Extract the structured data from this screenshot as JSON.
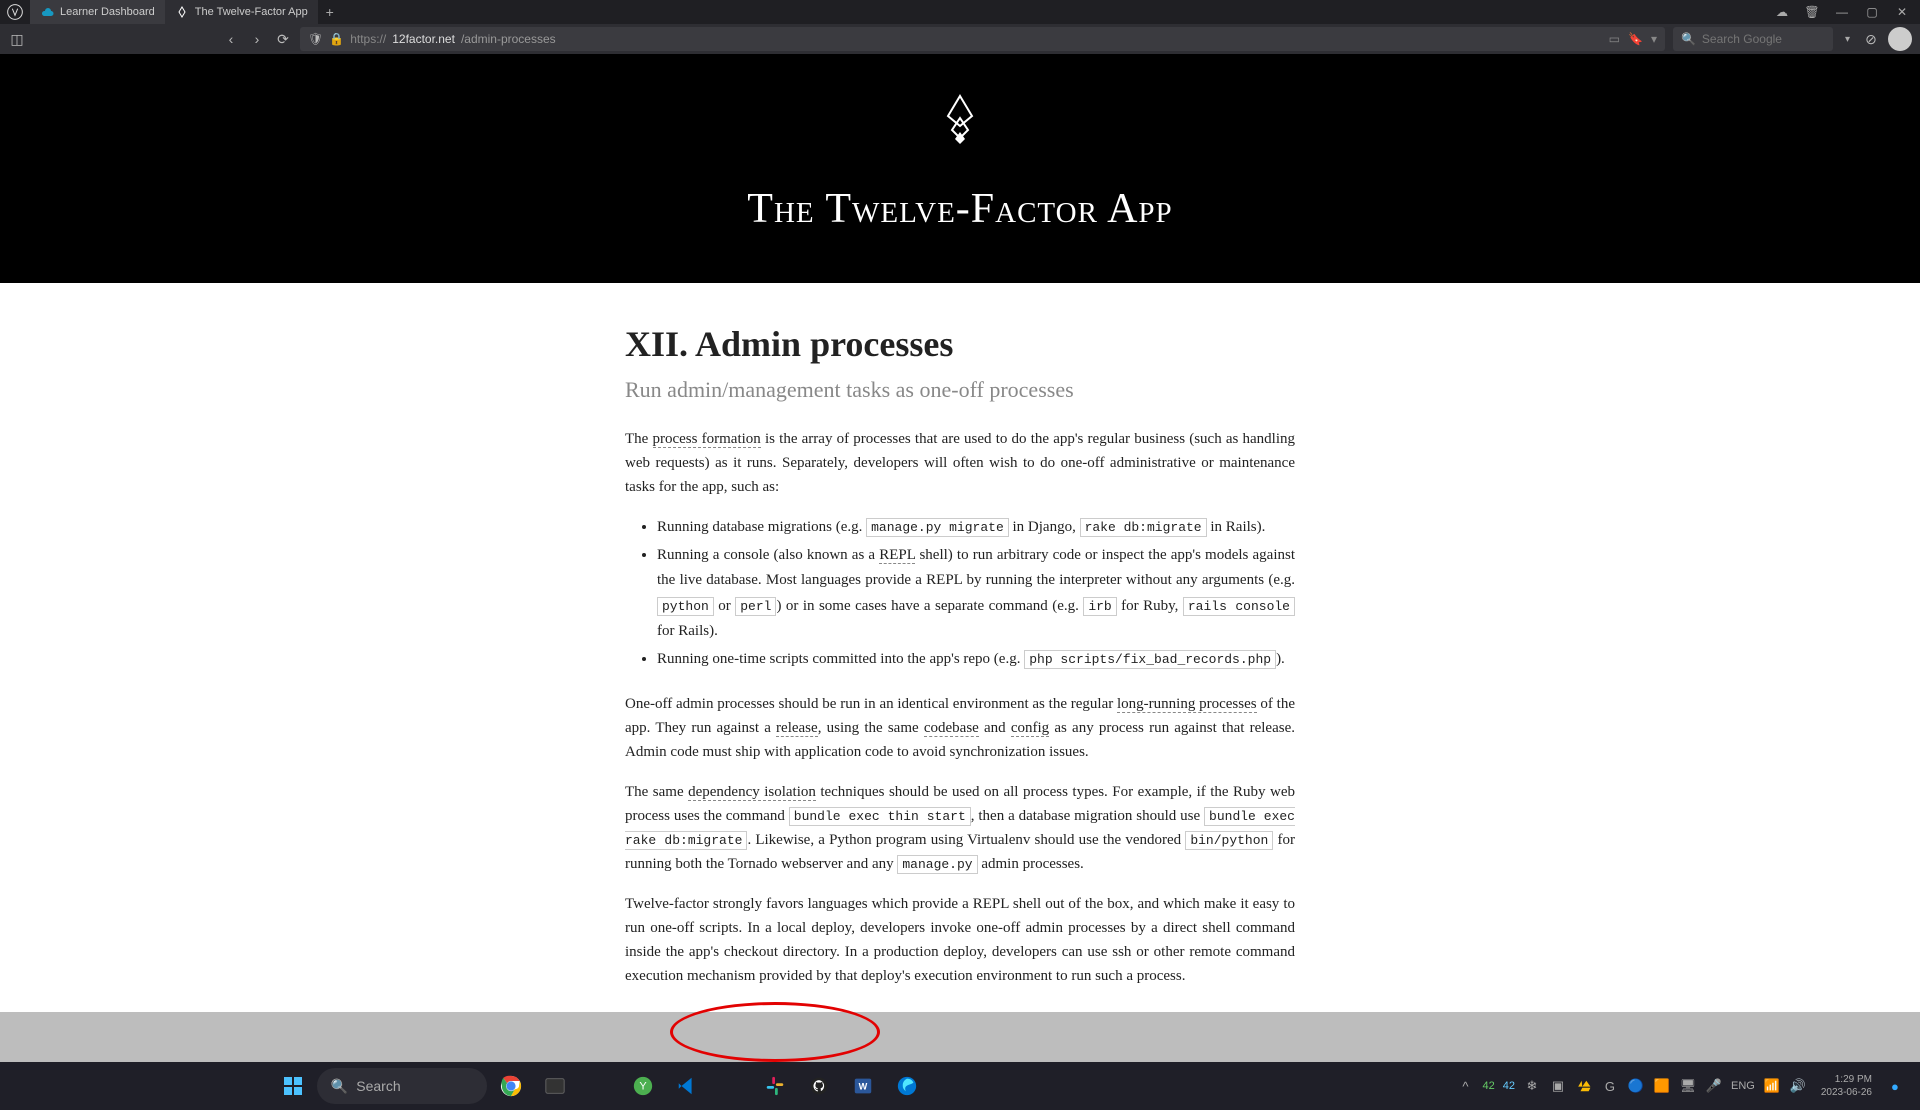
{
  "browser": {
    "tabs": [
      {
        "title": "Learner Dashboard",
        "active": false
      },
      {
        "title": "The Twelve-Factor App",
        "active": true
      }
    ],
    "url": {
      "protocol": "https://",
      "domain": "12factor.net",
      "path": "/admin-processes"
    },
    "search_placeholder": "Search Google"
  },
  "page": {
    "hero_title": "The Twelve-Factor App",
    "heading": "XII. Admin processes",
    "subtitle": "Run admin/management tasks as one-off processes",
    "p1_a": "The ",
    "p1_link1": "process formation",
    "p1_b": " is the array of processes that are used to do the app's regular business (such as handling web requests) as it runs. Separately, developers will often wish to do one-off administrative or maintenance tasks for the app, such as:",
    "li1_a": "Running database migrations (e.g. ",
    "li1_c1": "manage.py migrate",
    "li1_b": " in Django, ",
    "li1_c2": "rake db:migrate",
    "li1_c": " in Rails).",
    "li2_a": "Running a console (also known as a ",
    "li2_link1": "REPL",
    "li2_b": " shell) to run arbitrary code or inspect the app's models against the live database. Most languages provide a REPL by running the interpreter without any arguments (e.g. ",
    "li2_c1": "python",
    "li2_c": " or ",
    "li2_c2": "perl",
    "li2_d": ") or in some cases have a separate command (e.g. ",
    "li2_c3": "irb",
    "li2_e": " for Ruby, ",
    "li2_c4": "rails console",
    "li2_f": " for Rails).",
    "li3_a": "Running one-time scripts committed into the app's repo (e.g. ",
    "li3_c1": "php scripts/fix_bad_records.php",
    "li3_b": ").",
    "p2_a": "One-off admin processes should be run in an identical environment as the regular ",
    "p2_link1": "long-running processes",
    "p2_b": " of the app. They run against a ",
    "p2_link2": "release",
    "p2_c": ", using the same ",
    "p2_link3": "codebase",
    "p2_d": " and ",
    "p2_link4": "config",
    "p2_e": " as any process run against that release. Admin code must ship with application code to avoid synchronization issues.",
    "p3_a": "The same ",
    "p3_link1": "dependency isolation",
    "p3_b": " techniques should be used on all process types. For example, if the Ruby web process uses the command ",
    "p3_c1": "bundle exec thin start",
    "p3_c": ", then a database migration should use ",
    "p3_c2": "bundle exec rake db:migrate",
    "p3_d": ". Likewise, a Python program using Virtualenv should use the vendored ",
    "p3_c3": "bin/python",
    "p3_e": " for running both the Tornado webserver and any ",
    "p3_c4": "manage.py",
    "p3_f": " admin processes.",
    "p4": "Twelve-factor strongly favors languages which provide a REPL shell out of the box, and which make it easy to run one-off scripts. In a local deploy, developers invoke one-off admin processes by a direct shell command inside the app's checkout directory. In a production deploy, developers can use ssh or other remote command execution mechanism provided by that deploy's execution environment to run such a process."
  },
  "taskbar": {
    "search_placeholder": "Search",
    "temp1": "42",
    "temp2": "42",
    "lang": "ENG",
    "time": "1:29 PM",
    "date": "2023-06-26"
  }
}
